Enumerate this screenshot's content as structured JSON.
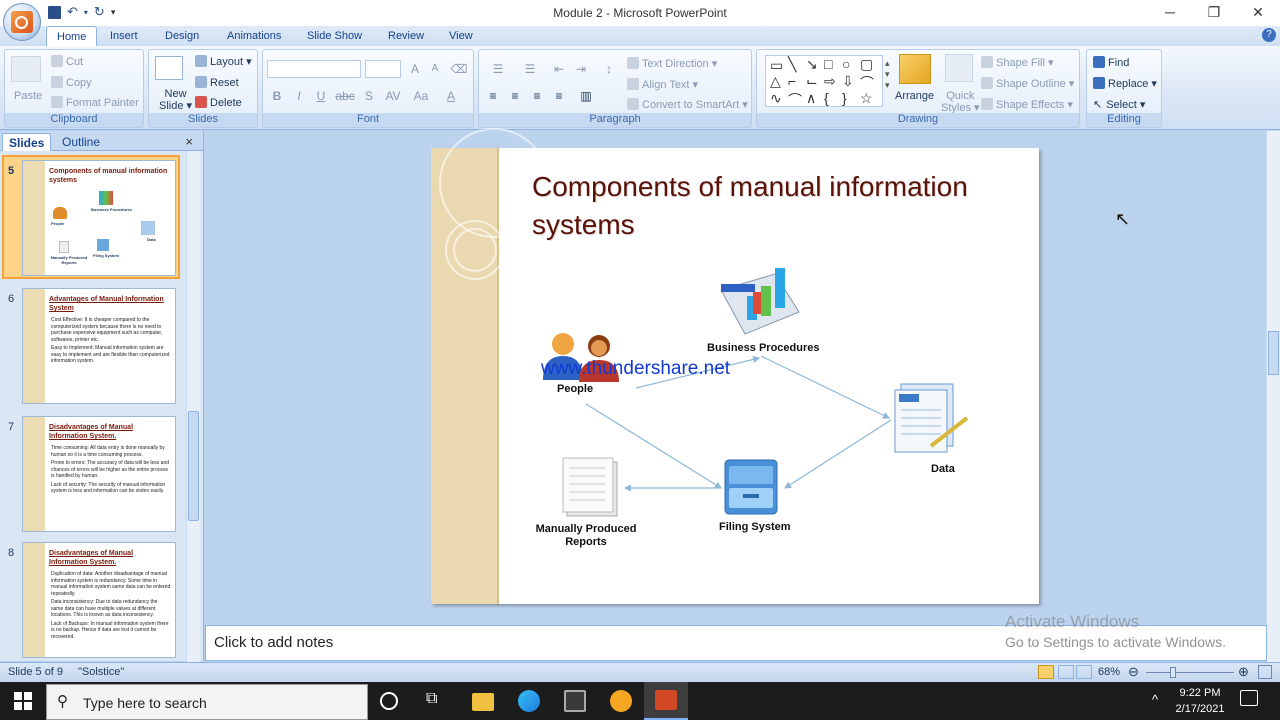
{
  "window": {
    "title": "Module 2 - Microsoft PowerPoint",
    "minimize": "─",
    "restore": "❐",
    "close": "✕"
  },
  "ribbon_tabs": [
    "Home",
    "Insert",
    "Design",
    "Animations",
    "Slide Show",
    "Review",
    "View"
  ],
  "clipboard": {
    "paste": "Paste",
    "cut": "Cut",
    "copy": "Copy",
    "format_painter": "Format Painter",
    "label": "Clipboard"
  },
  "slides_group": {
    "new_slide_1": "New",
    "new_slide_2": "Slide",
    "layout": "Layout",
    "reset": "Reset",
    "delete": "Delete",
    "label": "Slides"
  },
  "font_group": {
    "bold": "B",
    "italic": "I",
    "underline": "U",
    "strike": "abc",
    "shadow": "S",
    "spacing": "AV",
    "case": "Aa",
    "color": "A",
    "grow": "A",
    "shrink": "A",
    "label": "Font"
  },
  "paragraph_group": {
    "text_direction": "Text Direction",
    "align_text": "Align Text",
    "convert_smartart": "Convert to SmartArt",
    "label": "Paragraph"
  },
  "drawing_group": {
    "arrange": "Arrange",
    "quick_styles_1": "Quick",
    "quick_styles_2": "Styles",
    "shape_fill": "Shape Fill",
    "shape_outline": "Shape Outline",
    "shape_effects": "Shape Effects",
    "label": "Drawing"
  },
  "editing_group": {
    "find": "Find",
    "replace": "Replace",
    "select": "Select",
    "label": "Editing"
  },
  "panel": {
    "tab_slides": "Slides",
    "tab_outline": "Outline",
    "close": "×"
  },
  "thumbnails": [
    {
      "num": "5",
      "title": "Components of manual information systems",
      "labels": [
        "People",
        "Business Procedures",
        "Data",
        "Manually Produced Reports",
        "Filing System"
      ]
    },
    {
      "num": "6",
      "title": "Advantages of Manual Information System",
      "bullets": [
        "Cost Effective: It is cheaper compared to the computerized system because there is no need to purchase expensive equipment such as computer, softwares, printer etc.",
        "Easy to Implement: Manual information system are easy to implement and are flexible than computerized information system."
      ]
    },
    {
      "num": "7",
      "title": "Disadvantages of Manual Information System.",
      "bullets": [
        "Time consuming: All data entry is done manually by human so it is a time consuming process.",
        "Prone to errors: The accuracy of data will be less and chances of errors will be higher as the entire process is handled by human.",
        "Lack of security: The security of manual information system is less and information can be stolen easily."
      ]
    },
    {
      "num": "8",
      "title": "Disadvantages of Manual Information System.",
      "bullets": [
        "Duplication of data: Another disadvantage of manual information system is redundancy. Some time in manual information system same data can be entered repeatedly.",
        "Data inconsistency: Due to data redundancy the same data can have multiple values at different locations. This is known as data inconsistency.",
        "Lack of Backups: In manual information system there is no backup. Hence if data are lost it cannot be recovered."
      ]
    }
  ],
  "slide": {
    "title_line1": "Components of manual information",
    "title_line2": "systems",
    "nodes": {
      "people": "People",
      "business": "Business Procedures",
      "data": "Data",
      "reports_1": "Manually Produced",
      "reports_2": "Reports",
      "filing": "Filing System"
    },
    "watermark": "www.thundershare.net"
  },
  "notes": "Click to add notes",
  "activate": {
    "line1": "Activate Windows",
    "line2": "Go to Settings to activate Windows."
  },
  "status": {
    "slide_info": "Slide 5 of 9",
    "theme": "\"Solstice\"",
    "zoom": "68%"
  },
  "taskbar": {
    "search_placeholder": "Type here to search",
    "time": "9:22 PM",
    "date": "2/17/2021"
  }
}
